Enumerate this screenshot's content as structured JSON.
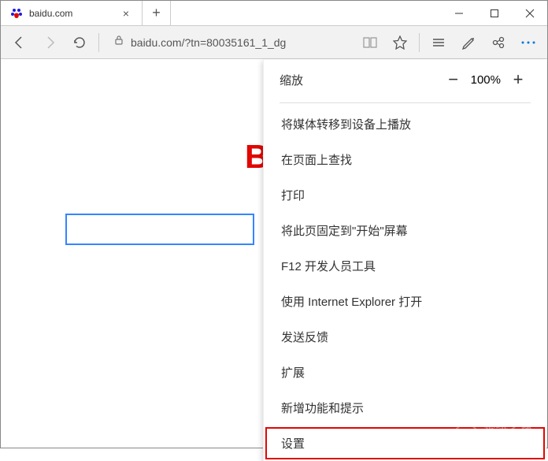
{
  "tab": {
    "title": "baidu.com",
    "favicon_color": "#2319dc"
  },
  "toolbar": {
    "url": "baidu.com/?tn=80035161_1_dg"
  },
  "page": {
    "logo_fragment": "B"
  },
  "menu": {
    "zoom": {
      "label": "缩放",
      "value": "100%"
    },
    "items": [
      "将媒体转移到设备上播放",
      "在页面上查找",
      "打印",
      "将此页固定到\"开始\"屏幕",
      "F12 开发人员工具",
      "使用 Internet Explorer 打开",
      "发送反馈",
      "扩展",
      "新增功能和提示",
      "设置"
    ]
  },
  "watermark": {
    "text": "系统之家",
    "sub": "XITONGZHIJIA.NET"
  }
}
